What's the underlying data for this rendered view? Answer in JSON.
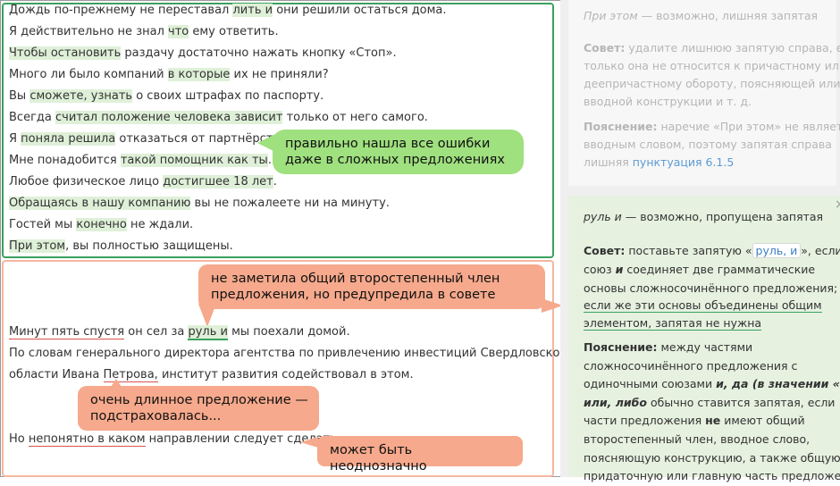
{
  "top_panel": {
    "lines": [
      [
        "Дождь по-прежнему не переставал ",
        "лить и",
        " они решили остаться дома."
      ],
      [
        "Я действительно не знал ",
        "что",
        " ему ответить."
      ],
      [
        "",
        "Чтобы остановить",
        " раздачу достаточно нажать кнопку «Стоп»."
      ],
      [
        "Много ли было компаний ",
        "в которые",
        " их не приняли?"
      ],
      [
        "Вы ",
        "сможете, узнать",
        " о своих штрафах по паспорту."
      ],
      [
        "Всегда ",
        "считал положение человека зависит",
        " только от него самого."
      ],
      [
        "Я ",
        "поняла решила",
        " отказаться от партнёрства."
      ],
      [
        "Мне понадобится ",
        "такой помощник как ты",
        "."
      ],
      [
        "Любое физическое лицо ",
        "достигшее 18 лет",
        "."
      ],
      [
        "",
        "Обращаясь в нашу компанию",
        " вы не пожалеете ни на минуту."
      ],
      [
        "Гостей мы ",
        "конечно",
        " не ждали."
      ],
      [
        "",
        "При этом",
        ", вы полностью защищены."
      ]
    ],
    "bubble": "правильно нашла все ошибки\nдаже в сложных предложениях"
  },
  "bottom_panel": {
    "bubble1": "не заметила общий второстепенный член\nпредложения, но предупредила в совете",
    "line1": [
      "",
      "Минут пять спустя",
      " он сел за ",
      "руль и",
      " мы поехали домой."
    ],
    "line2": "По словам генерального директора агентства по привлечению инвестиций Свердловской",
    "line3": [
      "области Ивана ",
      "Петрова,",
      " институт развития содействовал в этом."
    ],
    "bubble2": "очень длинное предложение —\nподстраховалась...",
    "line4": [
      "Но ",
      "непонятно в каком",
      " направлении следует сделать."
    ],
    "bubble3": "может быть неоднозначно"
  },
  "card_top": {
    "title_em": "При этом",
    "title_rest": " — возможно, лишняя запятая",
    "advice_label": "Совет:",
    "advice_lines": [
      " удалите лишнюю запятую справа, если",
      "только она не относится к причастному или",
      "деепричастному обороту, поясняющей или",
      "вводной конструкции и т. д."
    ],
    "expl_label": "Пояснение:",
    "expl_lines": [
      " наречие «При этом» не является",
      "вводным словом, поэтому запятая справа",
      "лишняя "
    ],
    "expl_link": "пунктуация 6.1.5"
  },
  "card_bottom": {
    "title_em": "руль и",
    "title_rest": " — возможно, пропущена запятая",
    "advice_label": "Совет:",
    "advice_pre": " поставьте запятую «",
    "advice_chip": "руль, и",
    "advice_post": "», если",
    "advice_lines": [
      "союз ",
      "и",
      " соединяет две грамматические",
      "основы сложносочинённого предложения;"
    ],
    "advice_ul1": "если же эти основы объединены общим",
    "advice_ul2": "элементом, запятая не нужна",
    "expl_label": "Пояснение:",
    "expl_lines": [
      " между частями",
      "сложносочинённого предложения с",
      "одиночными союзами ",
      "и, да (в значении «и»),",
      "или, либо",
      " обычно ставится запятая, если",
      "части предложения ",
      "не",
      " имеют общий",
      "второстепенный член, вводное слово,",
      "поясняющую конструкцию, а также общую",
      "придаточную или главную часть предложения"
    ],
    "close": "×"
  }
}
